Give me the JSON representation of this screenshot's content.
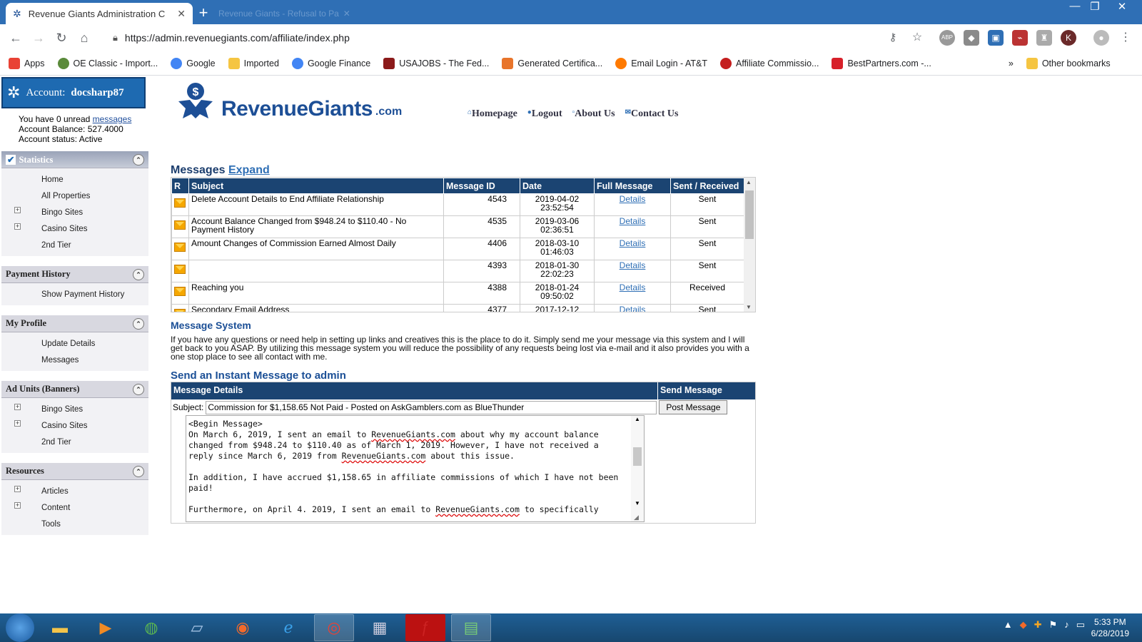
{
  "browser": {
    "tab_title": "Revenue Giants Administration C",
    "inactive_tab_title": "Revenue Giants - Refusal to Pa",
    "url": "https://admin.revenuegiants.com/affiliate/index.php",
    "bookmarks": [
      {
        "label": "Apps",
        "color": "#e94235"
      },
      {
        "label": "OE Classic - Import...",
        "color": "#5a8a3a"
      },
      {
        "label": "Google",
        "color": "#4285f4"
      },
      {
        "label": "Imported",
        "color": "#f5c542"
      },
      {
        "label": "Google Finance",
        "color": "#4285f4"
      },
      {
        "label": "USAJOBS - The Fed...",
        "color": "#8b1a1a"
      },
      {
        "label": "Generated Certifica...",
        "color": "#e8742a"
      },
      {
        "label": "Email Login - AT&T",
        "color": "#ff7a00"
      },
      {
        "label": "Affiliate Commissio...",
        "color": "#c41e1e"
      },
      {
        "label": "BestPartners.com -...",
        "color": "#d7202a"
      }
    ],
    "other_bookmarks": "Other bookmarks",
    "overflow": "»"
  },
  "account": {
    "label": "Account:",
    "name": "docsharp87",
    "unread_prefix": "You have 0 unread",
    "unread_link": "messages",
    "balance": "Account Balance: 527.4000",
    "status": "Account status: Active"
  },
  "sidebar": {
    "statistics": {
      "title": "Statistics",
      "items": [
        "Home",
        "All Properties",
        "Bingo Sites",
        "Casino Sites",
        "2nd Tier"
      ]
    },
    "payment": {
      "title": "Payment History",
      "items": [
        "Show Payment History"
      ]
    },
    "profile": {
      "title": "My Profile",
      "items": [
        "Update Details",
        "Messages"
      ]
    },
    "adunits": {
      "title": "Ad Units (Banners)",
      "items": [
        "Bingo Sites",
        "Casino Sites",
        "2nd Tier"
      ]
    },
    "resources": {
      "title": "Resources",
      "items": [
        "Articles",
        "Content",
        "Tools"
      ]
    }
  },
  "header": {
    "brand": "RevenueGiants",
    "brand_suffix": ".com",
    "nav": [
      "Homepage",
      "Logout",
      "About Us",
      "Contact Us"
    ]
  },
  "messages": {
    "title": "Messages",
    "expand": "Expand",
    "columns": [
      "R",
      "Subject",
      "Message ID",
      "Date",
      "Full Message",
      "Sent / Received"
    ],
    "rows": [
      {
        "subject": "Delete Account Details to End Affiliate Relationship",
        "id": "4543",
        "date": "2019-04-02",
        "time": "23:52:54",
        "link": "Details",
        "dir": "Sent"
      },
      {
        "subject": "Account Balance Changed from $948.24 to $110.40 - No Payment History",
        "id": "4535",
        "date": "2019-03-06",
        "time": "02:36:51",
        "link": "Details",
        "dir": "Sent"
      },
      {
        "subject": "Amount Changes of Commission Earned Almost Daily",
        "id": "4406",
        "date": "2018-03-10",
        "time": "01:46:03",
        "link": "Details",
        "dir": "Sent"
      },
      {
        "subject": "",
        "id": "4393",
        "date": "2018-01-30",
        "time": "22:02:23",
        "link": "Details",
        "dir": "Sent"
      },
      {
        "subject": "Reaching you",
        "id": "4388",
        "date": "2018-01-24",
        "time": "09:50:02",
        "link": "Details",
        "dir": "Received"
      },
      {
        "subject": "Secondary Email Address",
        "id": "4377",
        "date": "2017-12-12",
        "time": "",
        "link": "Details",
        "dir": "Sent"
      }
    ]
  },
  "system": {
    "title": "Message System",
    "text": "If you have any questions or need help in setting up links and creatives this is the place to do it. Simply send me your message via this system and I will get back to you ASAP. By utilizing this message system you will reduce the possibility of any requests being lost via e-mail and it also provides you with a one stop place to see all contact with me."
  },
  "send": {
    "title": "Send an Instant Message to admin",
    "col_details": "Message Details",
    "col_send": "Send Message",
    "subject_label": "Subject:",
    "subject_value": "Commission for $1,158.65 Not Paid - Posted on AskGamblers.com as BlueThunder",
    "button": "Post Message",
    "body_line1": "<Begin Message>",
    "body_p1a": "On March 6, 2019, I sent an email to ",
    "body_p1_link": "RevenueGiants.com",
    "body_p1b": " about why my account balance changed from $948.24 to $110.40 as of March 1, 2019. However, I have not received a reply since March 6, 2019 from ",
    "body_p1_link2": "RevenueGiants.com",
    "body_p1c": " about this issue.",
    "body_p2": "In addition, I have accrued $1,158.65 in affiliate commissions of which I have not been paid!",
    "body_p3a": "Furthermore, on April 4. 2019, I sent an email to ",
    "body_p3_link": "RevenueGiants.com",
    "body_p3b": " to specifically"
  },
  "taskbar": {
    "time": "5:33 PM",
    "date": "6/28/2019"
  }
}
